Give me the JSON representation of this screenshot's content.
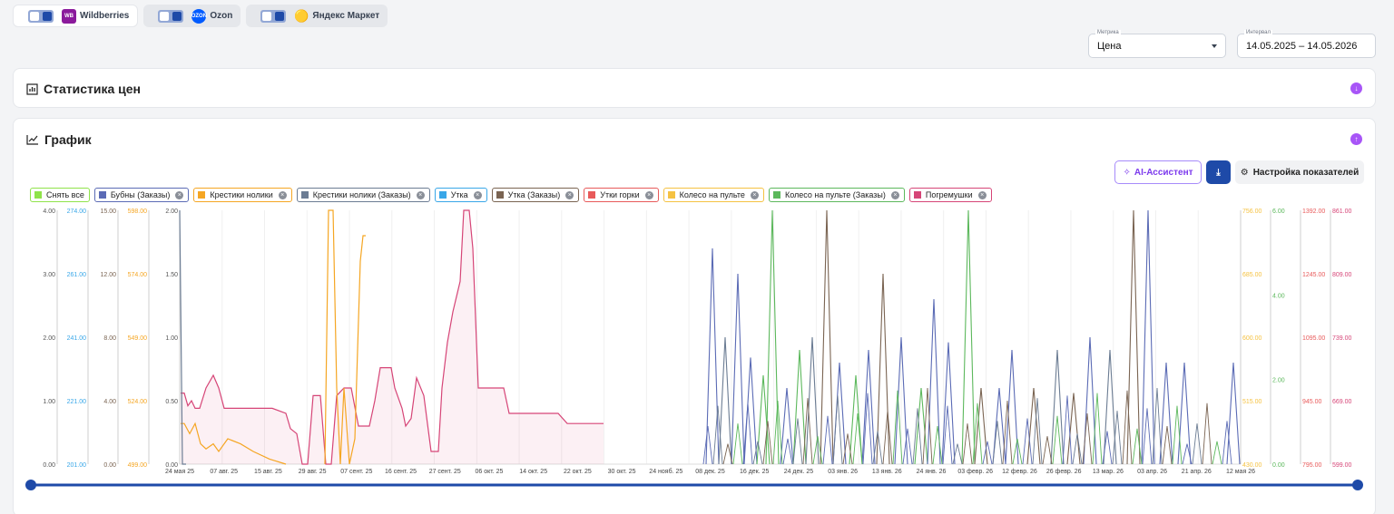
{
  "marketplaces": [
    {
      "name": "Wildberries",
      "logo": "WB",
      "enabled": true
    },
    {
      "name": "Ozon",
      "logo": "OZON",
      "enabled": true
    },
    {
      "name": "Яндекс Маркет",
      "logo": "ym-logo",
      "enabled": true
    }
  ],
  "filters": {
    "metric_label": "Метрика",
    "metric_value": "Цена",
    "interval_label": "Интервал",
    "interval_value": "14.05.2025 – 14.05.2026"
  },
  "price_stats": {
    "title": "Статистика цен",
    "icon": "bar-chart-icon",
    "toggle_icon": "arrow-down-circle-icon"
  },
  "graph": {
    "title": "График",
    "icon": "line-chart-icon",
    "toggle_icon": "arrow-up-circle-icon",
    "ai_button": "AI-Ассистент",
    "download_icon": "download-icon",
    "settings_button": "Настройка показателей"
  },
  "colors": {
    "accent": "#1e4aa8",
    "purple": "#a855f7"
  },
  "chart_data": {
    "type": "line",
    "x_ticks": [
      "24 мая 25",
      "07 авг. 25",
      "15 авг. 25",
      "29 авг. 25",
      "07 сент. 25",
      "16 сент. 25",
      "27 сент. 25",
      "06 окт. 25",
      "14 окт. 25",
      "22 окт. 25",
      "30 окт. 25",
      "24 нояб. 25",
      "08 дек. 25",
      "16 дек. 25",
      "24 дек. 25",
      "03 янв. 26",
      "13 янв. 26",
      "24 янв. 26",
      "03 февр. 26",
      "12 февр. 26",
      "26 февр. 26",
      "13 мар. 26",
      "03 апр. 26",
      "21 апр. 26",
      "12 мая 26"
    ],
    "legend": [
      {
        "name": "Снять все",
        "color": "#8fe34a",
        "has_close": false
      },
      {
        "name": "Бубны (Заказы)",
        "color": "#5b6bb5",
        "has_close": true
      },
      {
        "name": "Крестики нолики",
        "color": "#f5a623",
        "has_close": true
      },
      {
        "name": "Крестики нолики (Заказы)",
        "color": "#6b7c93",
        "has_close": true
      },
      {
        "name": "Утка",
        "color": "#39a7e8",
        "has_close": true
      },
      {
        "name": "Утка (Заказы)",
        "color": "#7a6452",
        "has_close": true
      },
      {
        "name": "Утки горки",
        "color": "#e85a5a",
        "has_close": true
      },
      {
        "name": "Колесо на пульте",
        "color": "#f5c242",
        "has_close": true
      },
      {
        "name": "Колесо на пульте (Заказы)",
        "color": "#5cb85c",
        "has_close": true
      },
      {
        "name": "Погремушки",
        "color": "#d64577",
        "has_close": true
      }
    ],
    "axes_left": [
      {
        "color": "#555555",
        "ticks": [
          "4.00",
          "3.00",
          "2.00",
          "1.00",
          "0.00"
        ]
      },
      {
        "color": "#39a7e8",
        "ticks": [
          "274.00",
          "261.00",
          "241.00",
          "221.00",
          "201.00"
        ]
      },
      {
        "color": "#7a6452",
        "ticks": [
          "15.00",
          "12.00",
          "8.00",
          "4.00",
          "0.00"
        ]
      },
      {
        "color": "#f5a623",
        "ticks": [
          "598.00",
          "574.00",
          "549.00",
          "524.00",
          "499.00"
        ]
      },
      {
        "color": "#555555",
        "ticks": [
          "2.00",
          "1.50",
          "1.00",
          "0.50",
          "0.00"
        ]
      }
    ],
    "axes_right": [
      {
        "color": "#f5c242",
        "ticks": [
          "756.00",
          "685.00",
          "600.00",
          "515.00",
          "430.00"
        ]
      },
      {
        "color": "#5cb85c",
        "ticks": [
          "6.00",
          "4.00",
          "2.00",
          "0.00"
        ]
      },
      {
        "color": "#e85a5a",
        "ticks": [
          "1392.00",
          "1245.00",
          "1095.00",
          "945.00",
          "795.00"
        ]
      },
      {
        "color": "#d64577",
        "ticks": [
          "861.00",
          "809.00",
          "739.00",
          "669.00",
          "599.00"
        ]
      }
    ],
    "slider_range": [
      "14.05.2025",
      "14.05.2026"
    ]
  }
}
